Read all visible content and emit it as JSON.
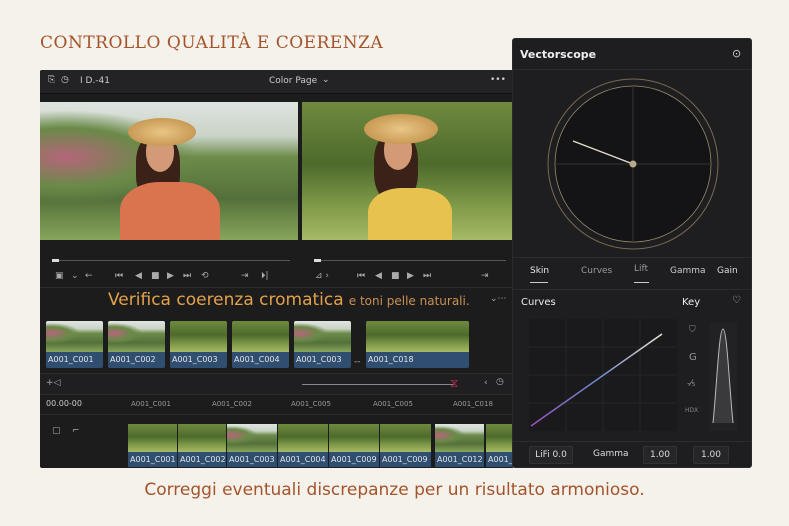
{
  "title": "CONTROLLO QUALITÀ E COERENZA",
  "caption": "Correggi eventuali discrepanze per un risultato armonioso.",
  "topbar": {
    "clip_id": "I D.-41",
    "page_selector": "Color Page",
    "more": "•••"
  },
  "overlay": {
    "headline": "Verifica coerenza cromatica",
    "subline": "e toni pelle naturali."
  },
  "thumbnails": [
    {
      "label": "A001_C001"
    },
    {
      "label": "A001_C002"
    },
    {
      "label": "A001_C003"
    },
    {
      "label": "A001_C004"
    },
    {
      "label": "A001_C003"
    },
    {
      "label": "A001_C018"
    }
  ],
  "thumb_separator": "--",
  "timecode": "00.00-00",
  "ruler_labels": [
    "A001_C001",
    "A001_C002",
    "A001_C005",
    "A001_C005",
    "A001_C018"
  ],
  "timeline_clips": [
    {
      "label": "A001_C001"
    },
    {
      "label": "A001_C002"
    },
    {
      "label": "A001_C003"
    },
    {
      "label": "A001_C004"
    },
    {
      "label": "A001_C009"
    },
    {
      "label": "A001_C009"
    },
    {
      "label": "A001_C012"
    },
    {
      "label": "A001_C"
    }
  ],
  "vectorscope": {
    "title": "Vectorscope"
  },
  "tabs": [
    {
      "label": "Skin",
      "active": true
    },
    {
      "label": "Curves",
      "active": false
    },
    {
      "label": "Lift",
      "active": true
    },
    {
      "label": "Gamma",
      "active": false
    },
    {
      "label": "Gain",
      "active": false
    }
  ],
  "curves": {
    "title": "Curves",
    "key_title": "Key",
    "key_icons": [
      "G",
      "-⁄₅",
      "HDX"
    ]
  },
  "bottom": {
    "lift": "LiFi 0.0",
    "gamma_label": "Gamma",
    "gamma_value": "1.00",
    "gain_value": "1.00"
  },
  "colors": {
    "accent": "#a4532b",
    "overlay": "#e3a24a",
    "clip": "#2f4e70",
    "panel": "#1c1c1d"
  }
}
